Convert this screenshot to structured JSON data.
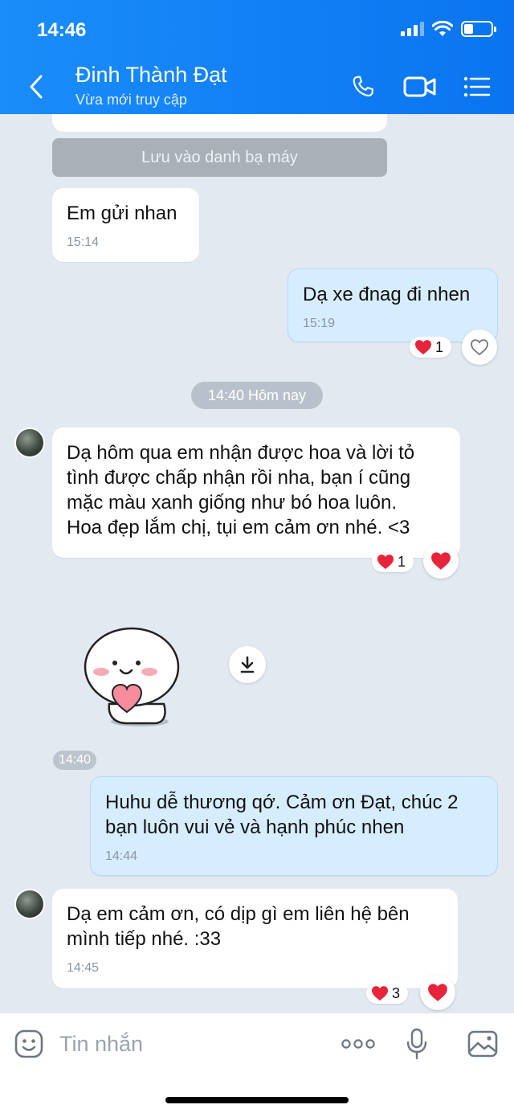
{
  "status_bar": {
    "time": "14:46"
  },
  "header": {
    "contact_name": "Đinh Thành Đạt",
    "contact_status": "Vừa mới truy cập",
    "icons": [
      "back-icon",
      "phone-icon",
      "video-call-icon",
      "menu-icon"
    ]
  },
  "chat": {
    "save_contact_label": "Lưu vào danh bạ máy",
    "time_separator": "14:40 Hôm nay",
    "messages": [
      {
        "sender": "them",
        "text": "Em gửi nhan",
        "time": "15:14"
      },
      {
        "sender": "me",
        "text": "Dạ xe đnag đi nhen",
        "time": "15:19",
        "reaction_count": "1"
      },
      {
        "sender": "them",
        "lines": [
          "Dạ hôm qua em nhận được hoa và lời tỏ",
          "tình được chấp nhận rồi nha, bạn í cũng",
          "mặc màu xanh giống như bó hoa luôn.",
          "Hoa đẹp lắm chị, tụi em cảm ơn nhé. <3"
        ],
        "reaction_count": "1"
      },
      {
        "sender": "them",
        "type": "sticker",
        "time": "14:40"
      },
      {
        "sender": "me",
        "lines": [
          "Huhu dễ thương qớ. Cảm ơn Đạt, chúc 2",
          "bạn luôn vui vẻ và hạnh phúc nhen"
        ],
        "time": "14:44"
      },
      {
        "sender": "them",
        "lines": [
          "Dạ em cảm ơn, có dịp gì em liên hệ bên",
          "mình tiếp nhé. :33"
        ],
        "time": "14:45",
        "reaction_count": "3"
      }
    ]
  },
  "composer": {
    "placeholder": "Tin nhắn",
    "icons": [
      "emoji-icon",
      "more-icon",
      "microphone-icon",
      "image-icon"
    ]
  },
  "colors": {
    "header_blue": "#0a74f0",
    "chat_background": "#e2e9f1",
    "outgoing_bubble": "#d6edfd",
    "heart_red": "#e8243a"
  }
}
